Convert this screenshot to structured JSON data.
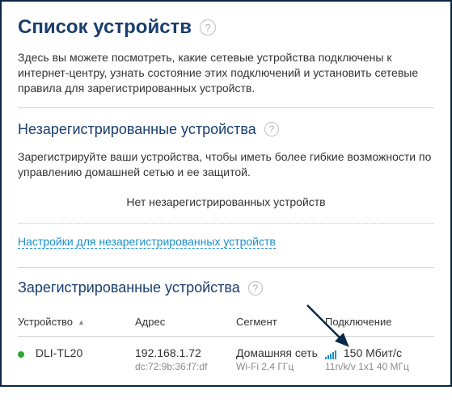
{
  "page": {
    "title": "Список устройств",
    "intro": "Здесь вы можете посмотреть, какие сетевые устройства подключены к интернет-центру, узнать состояние этих подключений и установить сетевые правила для зарегистрированных устройств."
  },
  "unregistered": {
    "title": "Незарегистрированные устройства",
    "intro": "Зарегистрируйте ваши устройства, чтобы иметь более гибкие возможности по управлению домашней сетью и ее защитой.",
    "empty": "Нет незарегистрированных устройств",
    "settings_link": "Настройки для незарегистрированных устройств"
  },
  "registered": {
    "title": "Зарегистрированные устройства",
    "columns": {
      "device": "Устройство",
      "address": "Адрес",
      "segment": "Сегмент",
      "connection": "Подключение"
    },
    "rows": [
      {
        "name": "DLI-TL20",
        "ip": "192.168.1.72",
        "mac": "dc:72:9b:36:f7:df",
        "segment": "Домашняя сеть",
        "band": "Wi-Fi 2,4 ГГц",
        "speed": "150 Мбит/с",
        "mode": "11n/k/v 1x1 40 МГц"
      }
    ]
  }
}
